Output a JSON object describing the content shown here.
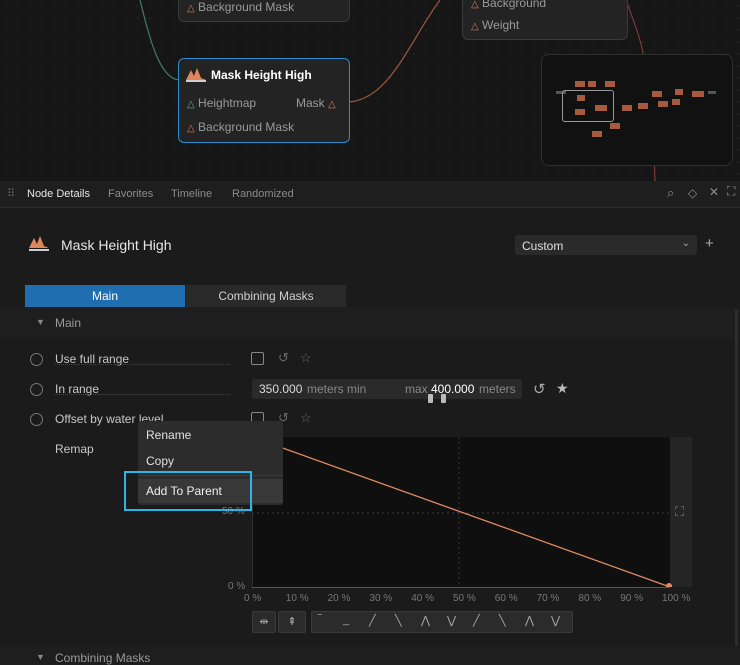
{
  "graph": {
    "node_top_port": "Background Mask",
    "node_right_ports": [
      "Background",
      "Weight"
    ],
    "selected_node": {
      "title": "Mask Height High",
      "ports": [
        "Heightmap",
        "Mask",
        "Background Mask"
      ]
    }
  },
  "tabs": [
    "Node Details",
    "Favorites",
    "Timeline",
    "Randomized"
  ],
  "header": {
    "title": "Mask Height High",
    "preset": "Custom",
    "add": "+"
  },
  "segments": [
    "Main",
    "Combining Masks"
  ],
  "section": {
    "title": "Main"
  },
  "rows": {
    "use_full_range": "Use full range",
    "in_range": "In range",
    "offset": "Offset by water level",
    "remap": "Remap"
  },
  "range": {
    "min_value": "350.000",
    "min_unit": "meters min",
    "max_label": "max",
    "max_value": "400.000",
    "max_unit": "meters"
  },
  "context_menu": {
    "rename": "Rename",
    "copy": "Copy",
    "add_to_parent": "Add To Parent"
  },
  "chart_data": {
    "type": "line",
    "x": [
      0,
      100
    ],
    "y": [
      100,
      0
    ],
    "x_ticks": [
      "0 %",
      "10 %",
      "20 %",
      "30 %",
      "40 %",
      "50 %",
      "60 %",
      "70 %",
      "80 %",
      "90 %",
      "100 %"
    ],
    "y_ticks": [
      "0 %",
      "50 %"
    ],
    "xlim": [
      0,
      100
    ],
    "ylim": [
      0,
      100
    ]
  },
  "bottom_section": "Combining Masks",
  "colors": {
    "accent": "#1f6fb0",
    "curve": "#e08a62",
    "highlight": "#2bb5e8"
  }
}
